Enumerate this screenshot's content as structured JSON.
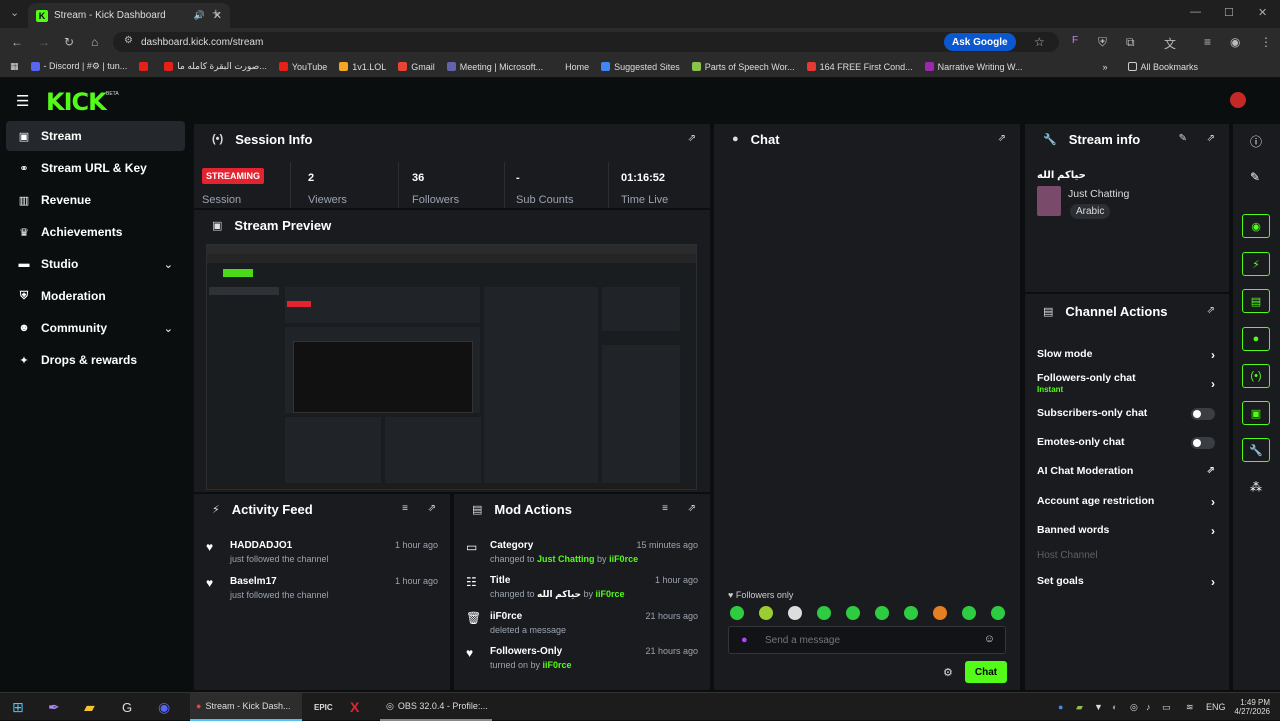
{
  "browser": {
    "tab_title": "Stream - Kick Dashboard",
    "url": "dashboard.kick.com/stream",
    "ask_google": "Ask Google",
    "bookmarks": [
      "- Discord | #⚙ | tun...",
      "",
      "صورت البقرة كامله ما...",
      "YouTube",
      "1v1.LOL",
      "Gmail",
      "Meeting | Microsoft...",
      "Home",
      "Suggested Sites",
      "Parts of Speech Wor...",
      "164 FREE First Cond...",
      "Narrative Writing W..."
    ],
    "all_bookmarks": "All Bookmarks"
  },
  "app": {
    "logo": "KICK",
    "beta": "BETA"
  },
  "sidebar": {
    "items": [
      {
        "label": "Stream",
        "icon": "broadcast-icon"
      },
      {
        "label": "Stream URL & Key",
        "icon": "link-icon"
      },
      {
        "label": "Revenue",
        "icon": "chart-icon"
      },
      {
        "label": "Achievements",
        "icon": "trophy-icon"
      },
      {
        "label": "Studio",
        "icon": "studio-icon"
      },
      {
        "label": "Moderation",
        "icon": "shield-icon"
      },
      {
        "label": "Community",
        "icon": "community-icon"
      },
      {
        "label": "Drops & rewards",
        "icon": "gift-icon"
      }
    ]
  },
  "session": {
    "title": "Session Info",
    "status": "STREAMING",
    "status_label": "Session",
    "stats": [
      {
        "value": "2",
        "label": "Viewers"
      },
      {
        "value": "36",
        "label": "Followers"
      },
      {
        "value": "-",
        "label": "Sub Counts"
      },
      {
        "value": "01:16:52",
        "label": "Time Live"
      }
    ]
  },
  "preview": {
    "title": "Stream Preview"
  },
  "chat": {
    "title": "Chat",
    "followers_only": "Followers only",
    "placeholder": "Send a message",
    "send": "Chat"
  },
  "stream_info": {
    "title": "Stream info",
    "stream_title": "حياكم الله",
    "category": "Just Chatting",
    "language": "Arabic"
  },
  "channel_actions": {
    "title": "Channel Actions",
    "items": [
      {
        "label": "Slow mode",
        "type": "arrow"
      },
      {
        "label": "Followers-only chat",
        "sub": "Instant",
        "type": "arrow"
      },
      {
        "label": "Subscribers-only chat",
        "type": "toggle"
      },
      {
        "label": "Emotes-only chat",
        "type": "toggle"
      },
      {
        "label": "AI Chat Moderation",
        "type": "external"
      },
      {
        "label": "Account age restriction",
        "type": "arrow"
      },
      {
        "label": "Banned words",
        "type": "arrow"
      },
      {
        "label": "Host Channel",
        "type": "disabled"
      },
      {
        "label": "Set goals",
        "type": "arrow"
      }
    ]
  },
  "activity": {
    "title": "Activity Feed",
    "items": [
      {
        "name": "HADDADJO1",
        "text": "just followed the channel",
        "time": "1 hour ago"
      },
      {
        "name": "Baselm17",
        "text": "just followed the channel",
        "time": "1 hour ago"
      }
    ]
  },
  "mod": {
    "title": "Mod Actions",
    "items": [
      {
        "title": "Category",
        "pre": "changed to ",
        "hl": "Just Chatting",
        "mid": " by ",
        "user": "iiF0rce",
        "time": "15 minutes ago",
        "icon": "category-icon"
      },
      {
        "title": "Title",
        "pre": "changed to ",
        "hl": "حياكم الله",
        "mid": " by ",
        "user": "iiF0rce",
        "time": "1 hour ago",
        "icon": "title-icon"
      },
      {
        "title": "iiF0rce",
        "pre": "deleted a message",
        "hl": "",
        "mid": "",
        "user": "",
        "time": "21 hours ago",
        "icon": "trash-icon"
      },
      {
        "title": "Followers-Only",
        "pre": "turned on by ",
        "hl": "",
        "mid": "",
        "user": "iiF0rce",
        "time": "21 hours ago",
        "icon": "heart-icon"
      }
    ]
  },
  "taskbar": {
    "apps": [
      "Stream - Kick Dash...",
      "OBS 32.0.4 - Profile:..."
    ],
    "lang": "ENG",
    "time": "1:49 PM",
    "date": "4/27/2026"
  }
}
